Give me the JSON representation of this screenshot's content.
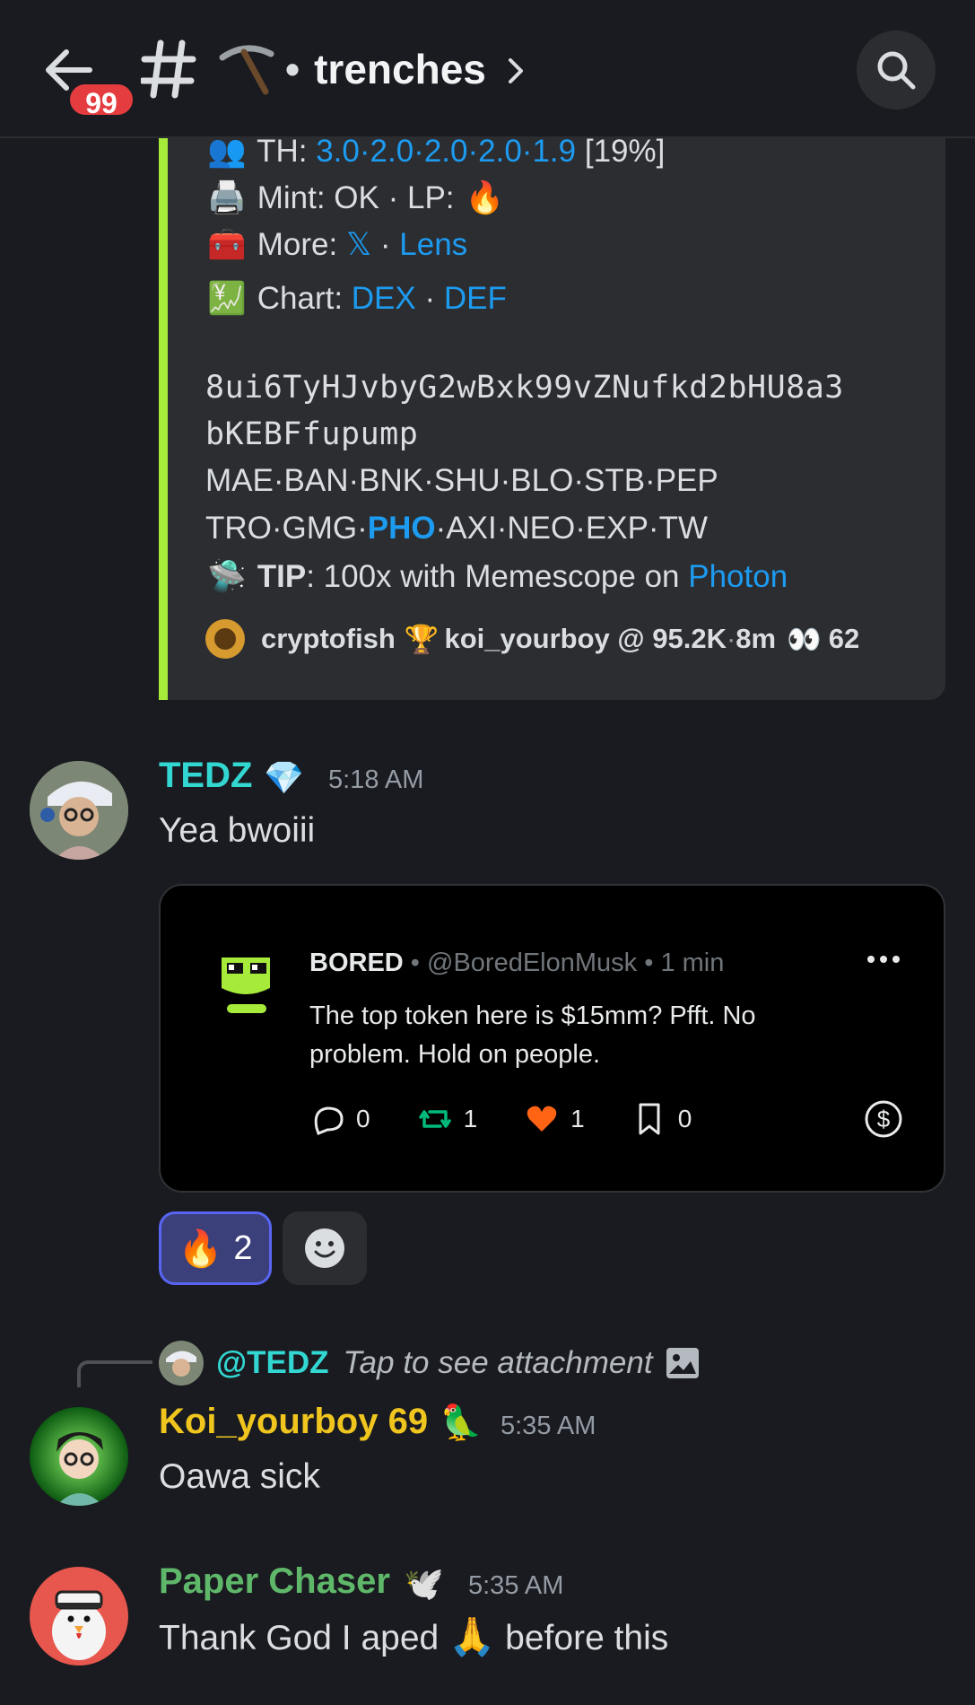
{
  "header": {
    "badge_count": "99",
    "channel_emoji": "⛏️",
    "channel_dot": "•",
    "channel_name": "trenches",
    "chevron": "›"
  },
  "embed": {
    "th_label": "TH:",
    "th_values": "3.0·2.0·2.0·2.0·1.9",
    "th_percent": "[19%]",
    "mint_label": "Mint: OK · LP:",
    "more_label": "More:",
    "more_x": "𝕏",
    "more_sep": "·",
    "more_lens": "Lens",
    "chart_label": "Chart:",
    "chart_dex": "DEX",
    "chart_sep": "·",
    "chart_def": "DEF",
    "address_line1": "8ui6TyHJvbyG2wBxk99vZNufkd2bHU8a3",
    "address_line2": "bKEBFfupump",
    "links_row1": "MAE·BAN·BNK·SHU·BLO·STB·PEP",
    "links_row2_a": "TRO·GMG·",
    "links_row2_bold": "PHO",
    "links_row2_b": "·AXI·NEO·EXP·TW",
    "tip_label": "TIP",
    "tip_text": ": 100x with Memescope on ",
    "tip_link": "Photon",
    "footer_caller": "cryptofish",
    "footer_rest": "koi_yourboy @ 95.2K",
    "footer_sep": " · ",
    "footer_age": "8m",
    "footer_views": "62"
  },
  "messages": [
    {
      "username": "TEDZ",
      "username_color": "#33d7d2",
      "badge": "💎",
      "time": "5:18 AM",
      "text": "Yea bwoiii"
    },
    {
      "username": "Koi_yourboy 69",
      "username_color": "#f0c61e",
      "badge": "🦜",
      "time": "5:35 AM",
      "text": "Oawa sick"
    },
    {
      "username": "Paper Chaser",
      "username_color": "#5fb86a",
      "badge": "🕊️",
      "time": "5:35 AM",
      "text_before": "Thank God I aped ",
      "text_emoji": "🙏",
      "text_after": " before this"
    }
  ],
  "tweet": {
    "name": "BORED",
    "handle": "@BoredElonMusk",
    "sep": "•",
    "age": "1 min",
    "body": "The top token here is $15mm? Pfft. No problem. Hold on people.",
    "replies": "0",
    "retweets": "1",
    "likes": "1",
    "bookmarks": "0"
  },
  "reactions": {
    "fire_emoji": "🔥",
    "fire_count": "2"
  },
  "reply_ref": {
    "mention": "@TEDZ",
    "hint": "Tap to see attachment"
  },
  "colors": {
    "background": "#1a1b20",
    "embed_bar": "#a6ea3a",
    "link": "#1d9bf0",
    "badge_red": "#e53c3f"
  },
  "icons": {
    "back": "arrow-left-icon",
    "channel": "hash-icon",
    "search": "search-icon",
    "add_reaction": "smiley-icon",
    "attachment": "image-icon"
  }
}
